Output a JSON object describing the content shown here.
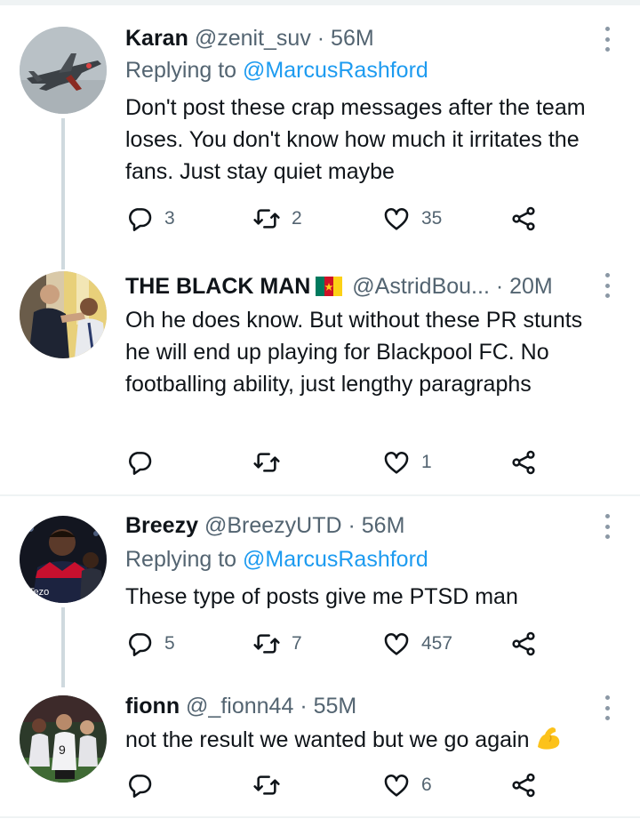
{
  "tweets": [
    {
      "name": "Karan",
      "handle": "@zenit_suv",
      "time": "· 56M",
      "reply_prefix": "Replying to ",
      "reply_to": "@MarcusRashford",
      "text": "Don't post these crap messages after the team loses. You don't know how much it irritates the fans. Just stay quiet maybe",
      "replies": "3",
      "retweets": "2",
      "likes": "35"
    },
    {
      "name": "THE BLACK MAN",
      "handle": "@AstridBou...",
      "time": "· 20M",
      "text": "Oh he does know. But without these PR stunts he will end up playing for Blackpool FC. No footballing ability, just lengthy paragraphs",
      "replies": "",
      "retweets": "",
      "likes": "1"
    },
    {
      "name": "Breezy",
      "handle": "@BreezyUTD",
      "time": "· 56M",
      "reply_prefix": "Replying to ",
      "reply_to": "@MarcusRashford",
      "text": "These type of posts give me PTSD man",
      "replies": "5",
      "retweets": "7",
      "likes": "457"
    },
    {
      "name": "fionn",
      "handle": "@_fionn44",
      "time": "· 55M",
      "text": "not the result we wanted but we go again",
      "replies": "",
      "retweets": "",
      "likes": "6"
    }
  ],
  "avatar_badge": "Tezo",
  "icons": {
    "reply": "reply-icon",
    "retweet": "retweet-icon",
    "like": "heart-icon",
    "share": "share-icon",
    "more": "more-options-icon",
    "flag": "cameroon-flag-icon",
    "emoji": "flexed-biceps-emoji"
  },
  "colors": {
    "text": "#0f1419",
    "secondary": "#536471",
    "link": "#1d9bf0",
    "divider": "#eff3f4",
    "thread_line": "#cfd9de"
  }
}
